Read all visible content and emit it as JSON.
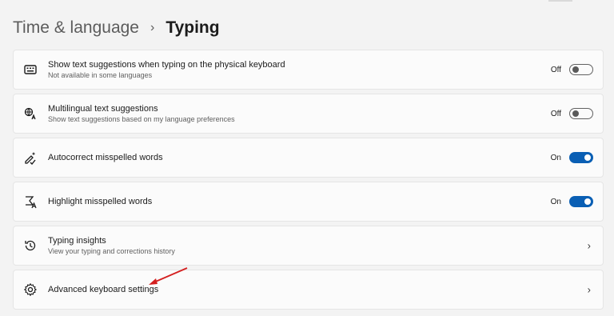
{
  "breadcrumb": {
    "parent": "Time & language",
    "separator": "›",
    "current": "Typing"
  },
  "settings": [
    {
      "title": "Show text suggestions when typing on the physical keyboard",
      "subtitle": "Not available in some languages",
      "state": "Off",
      "control": "toggle",
      "on": false,
      "icon": "keyboard-icon"
    },
    {
      "title": "Multilingual text suggestions",
      "subtitle": "Show text suggestions based on my language preferences",
      "state": "Off",
      "control": "toggle",
      "on": false,
      "icon": "multilingual-icon"
    },
    {
      "title": "Autocorrect misspelled words",
      "subtitle": "",
      "state": "On",
      "control": "toggle",
      "on": true,
      "icon": "autocorrect-icon"
    },
    {
      "title": "Highlight misspelled words",
      "subtitle": "",
      "state": "On",
      "control": "toggle",
      "on": true,
      "icon": "highlight-icon"
    },
    {
      "title": "Typing insights",
      "subtitle": "View your typing and corrections history",
      "control": "chevron",
      "chevron": "›",
      "icon": "history-icon"
    },
    {
      "title": "Advanced keyboard settings",
      "subtitle": "",
      "control": "chevron",
      "chevron": "›",
      "icon": "gear-icon"
    }
  ],
  "colors": {
    "accent": "#0a5fb4",
    "annotation_arrow": "#d42020",
    "background": "#f3f3f3",
    "card": "#fbfbfb"
  }
}
